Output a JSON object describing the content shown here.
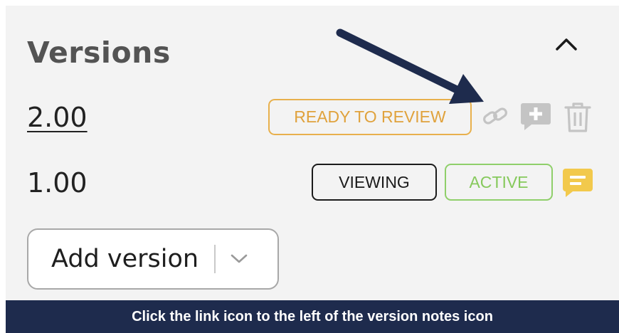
{
  "panel": {
    "title": "Versions",
    "collapse_icon": "chevron-up-icon"
  },
  "versions": [
    {
      "number": "2.00",
      "badges": [
        {
          "label": "READY TO REVIEW",
          "color": "#e8b04c"
        }
      ],
      "actions": [
        "link-icon",
        "add-note-icon",
        "trash-icon"
      ]
    },
    {
      "number": "1.00",
      "badges": [
        {
          "label": "VIEWING",
          "color": "#1b1b1b"
        },
        {
          "label": "ACTIVE",
          "color": "#8fcf6a"
        }
      ],
      "actions": [
        "version-notes-icon"
      ]
    }
  ],
  "add_version": {
    "label": "Add version",
    "icon": "chevron-down-icon"
  },
  "instruction": {
    "text": "Click the link icon to the left of the version notes icon"
  },
  "colors": {
    "panel_bg": "#f3f3f3",
    "banner_bg": "#1e2b4d",
    "arrow": "#1e2b4d",
    "note_yellow": "#f2c94c",
    "icon_gray": "#c4c4c4"
  }
}
